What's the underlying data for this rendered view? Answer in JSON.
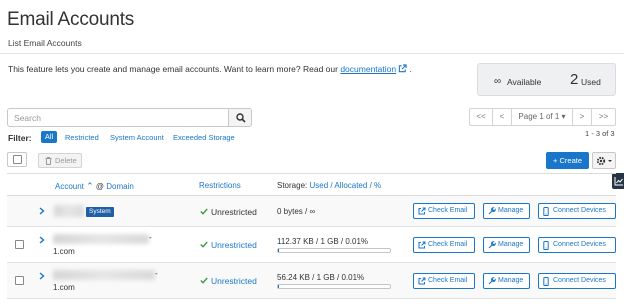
{
  "page": {
    "title": "Email Accounts",
    "subtitle": "List Email Accounts",
    "description_prefix": "This feature lets you create and manage email accounts. Want to learn more? Read our",
    "documentation_link": "documentation",
    "description_suffix": "."
  },
  "stats": {
    "available_symbol": "∞",
    "available_label": "Available",
    "used_count": "2",
    "used_label": "Used"
  },
  "search": {
    "placeholder": "Search"
  },
  "pagination": {
    "first": "<<",
    "prev": "<",
    "page_label": "Page 1 of 1",
    "next": ">",
    "last": ">>",
    "count": "1 - 3 of 3"
  },
  "filter": {
    "label": "Filter:",
    "options": [
      "All",
      "Restricted",
      "System Account",
      "Exceeded Storage"
    ]
  },
  "toolbar": {
    "delete_label": "Delete",
    "create_label": "Create"
  },
  "table": {
    "headers": {
      "account": "Account",
      "at": "@",
      "domain": "Domain",
      "restrictions": "Restrictions",
      "storage_prefix": "Storage:",
      "used": "Used",
      "sep1": "/",
      "allocated": "Allocated",
      "sep2": "/",
      "percent": "%"
    },
    "rows": [
      {
        "badge": "System",
        "restriction": "Unrestricted",
        "storage": "0 bytes / ∞",
        "usage_fraction": 0
      },
      {
        "domain_tail": "1.com",
        "restriction": "Unrestricted",
        "storage": "112.37 KB / 1 GB / 0.01%",
        "usage_fraction": 0.0001
      },
      {
        "domain_tail": "1.com",
        "restriction": "Unrestricted",
        "storage": "56.24 KB / 1 GB / 0.01%",
        "usage_fraction": 0.0001
      }
    ],
    "actions": {
      "check_email": "Check Email",
      "manage": "Manage",
      "connect_devices": "Connect Devices"
    }
  },
  "colors": {
    "accent": "#1a76c9",
    "success": "#3c9a45",
    "badge": "#1f5fa6"
  }
}
